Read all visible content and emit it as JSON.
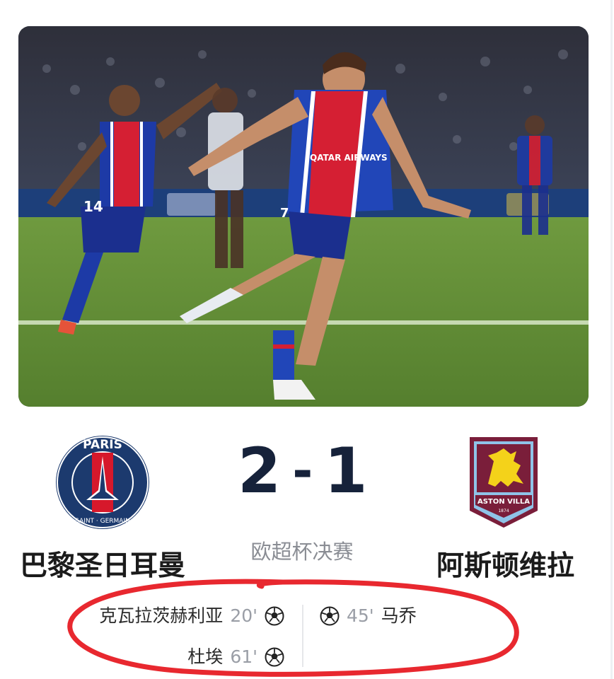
{
  "match": {
    "home_team": "巴黎圣日耳曼",
    "away_team": "阿斯顿维拉",
    "home_score": "2",
    "score_separator": "-",
    "away_score": "1",
    "competition": "欧超杯决赛"
  },
  "crests": {
    "home": {
      "icon": "psg-crest-icon",
      "top_text": "PARIS",
      "bottom_text": "SAINT · GERMAIN",
      "colors": {
        "navy": "#1c3a6e",
        "red": "#d6182b",
        "white": "#ffffff"
      }
    },
    "away": {
      "icon": "aston-villa-crest-icon",
      "banner_text": "ASTON VILLA",
      "year": "1874",
      "colors": {
        "claret": "#7a1e3a",
        "sky_blue": "#8fc3e8",
        "gold": "#f4d21a"
      }
    }
  },
  "scorers": {
    "home": [
      {
        "player": "克瓦拉茨赫利亚",
        "minute": "20'",
        "icon": "soccer-ball-icon"
      },
      {
        "player": "杜埃",
        "minute": "61'",
        "icon": "soccer-ball-icon"
      }
    ],
    "away": [
      {
        "player": "马乔",
        "minute": "45'",
        "icon": "soccer-ball-icon"
      }
    ]
  },
  "hero_photo": {
    "icon": "match-celebration-photo",
    "shirt_text": "QATAR AIRWAYS",
    "numbers": [
      "14",
      "7"
    ]
  },
  "annotation": {
    "color": "#e8282f"
  }
}
